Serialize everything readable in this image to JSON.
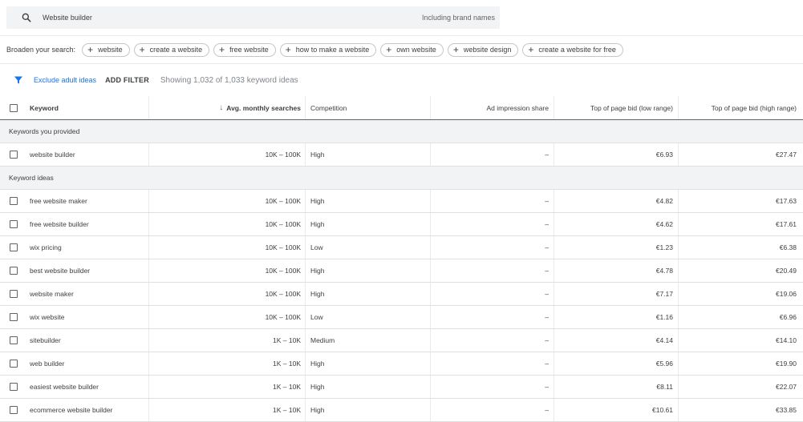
{
  "search": {
    "query": "Website builder",
    "brand_label": "Including brand names"
  },
  "broaden": {
    "label": "Broaden your search:",
    "chips": [
      "website",
      "create a website",
      "free website",
      "how to make a website",
      "own website",
      "website design",
      "create a website for free"
    ]
  },
  "filters": {
    "exclude": "Exclude adult ideas",
    "add": "ADD FILTER",
    "showing": "Showing 1,032 of 1,033 keyword ideas"
  },
  "columns": {
    "keyword": "Keyword",
    "avg": "Avg. monthly searches",
    "competition": "Competition",
    "ad_share": "Ad impression share",
    "low_bid": "Top of page bid (low range)",
    "high_bid": "Top of page bid (high range)"
  },
  "groups": [
    {
      "label": "Keywords you provided",
      "rows": [
        {
          "keyword": "website builder",
          "avg": "10K – 100K",
          "competition": "High",
          "ad_share": "–",
          "low": "€6.93",
          "high": "€27.47"
        }
      ]
    },
    {
      "label": "Keyword ideas",
      "rows": [
        {
          "keyword": "free website maker",
          "avg": "10K – 100K",
          "competition": "High",
          "ad_share": "–",
          "low": "€4.82",
          "high": "€17.63"
        },
        {
          "keyword": "free website builder",
          "avg": "10K – 100K",
          "competition": "High",
          "ad_share": "–",
          "low": "€4.62",
          "high": "€17.61"
        },
        {
          "keyword": "wix pricing",
          "avg": "10K – 100K",
          "competition": "Low",
          "ad_share": "–",
          "low": "€1.23",
          "high": "€6.38"
        },
        {
          "keyword": "best website builder",
          "avg": "10K – 100K",
          "competition": "High",
          "ad_share": "–",
          "low": "€4.78",
          "high": "€20.49"
        },
        {
          "keyword": "website maker",
          "avg": "10K – 100K",
          "competition": "High",
          "ad_share": "–",
          "low": "€7.17",
          "high": "€19.06"
        },
        {
          "keyword": "wix website",
          "avg": "10K – 100K",
          "competition": "Low",
          "ad_share": "–",
          "low": "€1.16",
          "high": "€6.96"
        },
        {
          "keyword": "sitebuilder",
          "avg": "1K – 10K",
          "competition": "Medium",
          "ad_share": "–",
          "low": "€4.14",
          "high": "€14.10"
        },
        {
          "keyword": "web builder",
          "avg": "1K – 10K",
          "competition": "High",
          "ad_share": "–",
          "low": "€5.96",
          "high": "€19.90"
        },
        {
          "keyword": "easiest website builder",
          "avg": "1K – 10K",
          "competition": "High",
          "ad_share": "–",
          "low": "€8.11",
          "high": "€22.07"
        },
        {
          "keyword": "ecommerce website builder",
          "avg": "1K – 10K",
          "competition": "High",
          "ad_share": "–",
          "low": "€10.61",
          "high": "€33.85"
        }
      ]
    }
  ]
}
